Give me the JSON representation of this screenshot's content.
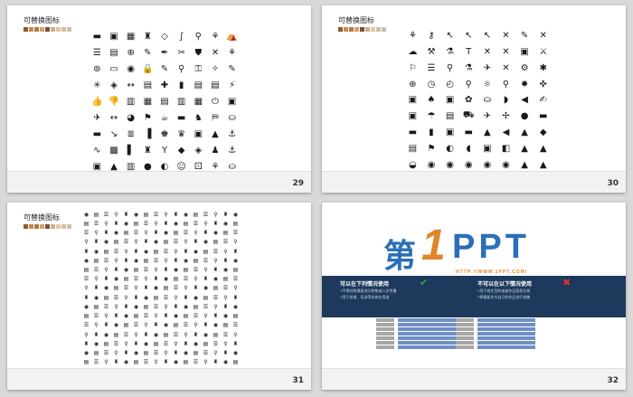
{
  "slides": [
    {
      "id": "s29",
      "number": "29",
      "title": "可替换图标",
      "colors": [
        "#8c5a2b",
        "#c98a4a",
        "#b07b45",
        "#d9a066",
        "#7a5230",
        "#c9b08f",
        "#e0c9a6",
        "#d3bfa1",
        "#c7c1b8"
      ]
    },
    {
      "id": "s30",
      "number": "30",
      "title": "可替换图标",
      "colors": [
        "#8c5a2b",
        "#c98a4a",
        "#b07b45",
        "#d9a066",
        "#7a5230",
        "#c9b08f",
        "#e0c9a6",
        "#d3bfa1",
        "#c7c1b8"
      ]
    },
    {
      "id": "s31",
      "number": "31",
      "title": "可替换图标",
      "colors": [
        "#8c5a2b",
        "#c98a4a",
        "#b07b45",
        "#d9a066",
        "#7a5230",
        "#c9b08f",
        "#e0c9a6",
        "#d3bfa1",
        "#c7c1b8"
      ]
    },
    {
      "id": "s32",
      "number": "32"
    }
  ],
  "icons29": [
    "▬",
    "▣",
    "▦",
    "♜",
    "◇",
    "∫",
    "⚲",
    "⚘",
    "⛺",
    "☰",
    "▤",
    "⊕",
    "✎",
    "✒",
    "✂",
    "⛊",
    "✕",
    "⚘",
    "⊚",
    "▭",
    "◉",
    "🔒",
    "✎",
    "⚲",
    "⚿",
    "✧",
    "✎",
    "✳",
    "◈",
    "↔",
    "▤",
    "✚",
    "▮",
    "▤",
    "▤",
    "⚡",
    "👍",
    "👎",
    "▥",
    "▦",
    "▤",
    "▥",
    "▦",
    "⏻",
    "▣",
    "✈",
    "↔",
    "◕",
    "⚑",
    "☕",
    "▬",
    "♞",
    "⛿",
    "⛀",
    "▬",
    "↘",
    "≣",
    "▐",
    "♚",
    "♛",
    "▣",
    "▲",
    "⚓",
    "∿",
    "▩",
    "▌",
    "♜",
    "Y",
    "◆",
    "◈",
    "♟",
    "⚓",
    "▣",
    "▲",
    "▥",
    "●",
    "◐",
    "☺",
    "⚀",
    "⚘",
    "⛀"
  ],
  "icons30": [
    "⚘",
    "⚷",
    "↖",
    "↖",
    "↖",
    "✕",
    "✎",
    "✕",
    "☁",
    "⚒",
    "⚗",
    "T",
    "✕",
    "✕",
    "▣",
    "⚔",
    "⚐",
    "☰",
    "⚲",
    "⚗",
    "✈",
    "✕",
    "⚙",
    "✱",
    "⊕",
    "◷",
    "◴",
    "⚲",
    "☼",
    "⚲",
    "✹",
    "✜",
    "▣",
    "♠",
    "▣",
    "✿",
    "⛀",
    "◗",
    "◀",
    "✍",
    "▣",
    "☂",
    "▤",
    "⛟",
    "✈",
    "✢",
    "●",
    "▬",
    "▬",
    "▮",
    "▣",
    "▬",
    "▲",
    "◀",
    "▲",
    "◆",
    "▤",
    "⚑",
    "◐",
    "◖",
    "▣",
    "◧",
    "▲",
    "▲",
    "◒",
    "◉",
    "◉",
    "◉",
    "◉",
    "◉",
    "▲",
    "▲"
  ],
  "band": {
    "left_title": "可以在下列情况使用",
    "left_lines": [
      "•不得对原模板进行转售或二次传播",
      "•用于授课、培训等非商业用途"
    ],
    "right_title": "不可以在以下情况使用",
    "right_lines": [
      "•用于商业目的或者作品版权交易",
      "•将模板作为自己的作品进行销售"
    ]
  },
  "logo": {
    "di": "第",
    "one": "1",
    "ppt": "PPT",
    "url": "HTTP://WWW.1PPT.COM/"
  },
  "icon_colors": {
    "dark": "#1a1a1a",
    "check": "#3aa04a",
    "cross": "#e03030"
  }
}
